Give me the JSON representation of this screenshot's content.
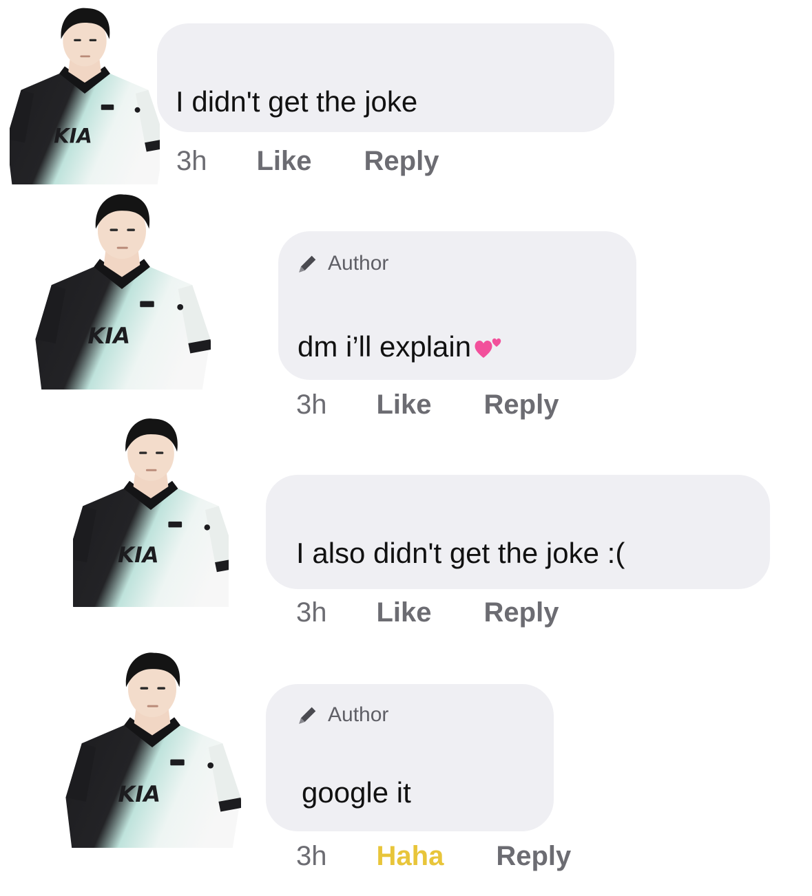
{
  "comments": [
    {
      "avatar": "kia-player-avatar",
      "author_badge": "",
      "text": "I didn't get the joke",
      "emoji": "",
      "time": "3h",
      "reaction": "Like",
      "reply": "Reply"
    },
    {
      "avatar": "kia-player-avatar",
      "author_badge": "Author",
      "text": "dm i’ll explain",
      "emoji": "two-hearts-icon",
      "time": "3h",
      "reaction": "Like",
      "reply": "Reply"
    },
    {
      "avatar": "kia-player-avatar",
      "author_badge": "",
      "text": "I also didn't get the joke :(",
      "emoji": "",
      "time": "3h",
      "reaction": "Like",
      "reply": "Reply"
    },
    {
      "avatar": "kia-player-avatar",
      "author_badge": "Author",
      "text": "google it",
      "emoji": "",
      "time": "3h",
      "reaction": "Haha",
      "reply": "Reply"
    }
  ],
  "colors": {
    "bubble": "#efeff3",
    "text": "#111111",
    "meta": "#6c6c72",
    "haha": "#e8c53a",
    "heart": "#f2509b"
  }
}
